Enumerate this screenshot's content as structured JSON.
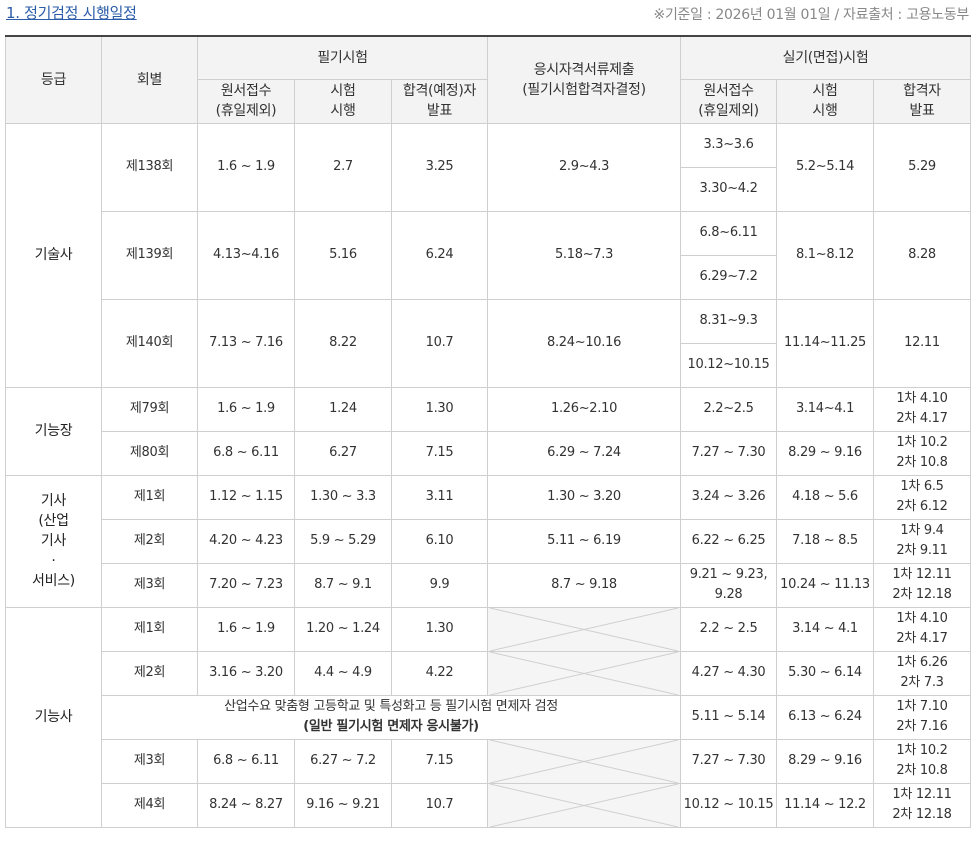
{
  "title": "1. 정기검정 시행일정",
  "note": "※기준일 : 2026년 01월 01일 / 자료출처 : 고용노동부",
  "headers": {
    "grade": "등급",
    "round": "회별",
    "written": "필기시험",
    "docs_line1": "응시자격서류제출",
    "docs_line2": "(필기시험합격자결정)",
    "practical": "실기(면접)시험",
    "apply_line1": "원서접수",
    "apply_line2": "(휴일제외)",
    "exam_line1": "시험",
    "exam_line2": "시행",
    "pass_exp_line1": "합격(예정)자",
    "pass_exp_line2": "발표",
    "p_apply_line1": "원서접수",
    "p_apply_line2": "(휴일제외)",
    "p_exam_line1": "시험",
    "p_exam_line2": "시행",
    "p_pass_line1": "합격자",
    "p_pass_line2": "발표"
  },
  "grades": {
    "gisulsa": "기술사",
    "gineungjang": "기능장",
    "gisa_line1": "기사",
    "gisa_line2": "(산업",
    "gisa_line3": "기사",
    "gisa_line4": "·",
    "gisa_line5": "서비스)",
    "gineungsa": "기능사"
  },
  "gisulsa": [
    {
      "round": "제138회",
      "w_apply": "1.6 ~ 1.9",
      "w_exam": "2.7",
      "w_pass": "3.25",
      "docs": "2.9~4.3",
      "p_apply_a": "3.3~3.6",
      "p_apply_b": "3.30~4.2",
      "p_exam": "5.2~5.14",
      "p_pass": "5.29"
    },
    {
      "round": "제139회",
      "w_apply": "4.13~4.16",
      "w_exam": "5.16",
      "w_pass": "6.24",
      "docs": "5.18~7.3",
      "p_apply_a": "6.8~6.11",
      "p_apply_b": "6.29~7.2",
      "p_exam": "8.1~8.12",
      "p_pass": "8.28"
    },
    {
      "round": "제140회",
      "w_apply": "7.13 ~ 7.16",
      "w_exam": "8.22",
      "w_pass": "10.7",
      "docs": "8.24~10.16",
      "p_apply_a": "8.31~9.3",
      "p_apply_b": "10.12~10.15",
      "p_exam": "11.14~11.25",
      "p_pass": "12.11"
    }
  ],
  "gineungjang": [
    {
      "round": "제79회",
      "w_apply": "1.6 ~ 1.9",
      "w_exam": "1.24",
      "w_pass": "1.30",
      "docs": "1.26~2.10",
      "p_apply": "2.2~2.5",
      "p_exam": "3.14~4.1",
      "p_pass_1": "1차 4.10",
      "p_pass_2": "2차 4.17"
    },
    {
      "round": "제80회",
      "w_apply": "6.8 ~ 6.11",
      "w_exam": "6.27",
      "w_pass": "7.15",
      "docs": "6.29 ~ 7.24",
      "p_apply": "7.27 ~ 7.30",
      "p_exam": "8.29 ~ 9.16",
      "p_pass_1": "1차 10.2",
      "p_pass_2": "2차 10.8"
    }
  ],
  "gisa": [
    {
      "round": "제1회",
      "w_apply": "1.12 ~ 1.15",
      "w_exam": "1.30 ~ 3.3",
      "w_pass": "3.11",
      "docs": "1.30 ~ 3.20",
      "p_apply_1": "3.24 ~ 3.26",
      "p_apply_2": "",
      "p_exam": "4.18 ~ 5.6",
      "p_pass_1": "1차 6.5",
      "p_pass_2": "2차 6.12"
    },
    {
      "round": "제2회",
      "w_apply": "4.20 ~ 4.23",
      "w_exam": "5.9 ~ 5.29",
      "w_pass": "6.10",
      "docs": "5.11 ~ 6.19",
      "p_apply_1": "6.22 ~ 6.25",
      "p_apply_2": "",
      "p_exam": "7.18 ~ 8.5",
      "p_pass_1": "1차 9.4",
      "p_pass_2": "2차 9.11"
    },
    {
      "round": "제3회",
      "w_apply": "7.20 ~ 7.23",
      "w_exam": "8.7 ~ 9.1",
      "w_pass": "9.9",
      "docs": "8.7 ~ 9.18",
      "p_apply_1": "9.21 ~ 9.23,",
      "p_apply_2": "9.28",
      "p_exam": "10.24 ~ 11.13",
      "p_pass_1": "1차 12.11",
      "p_pass_2": "2차 12.18"
    }
  ],
  "gineungsa": [
    {
      "round": "제1회",
      "w_apply": "1.6 ~ 1.9",
      "w_exam": "1.20 ~ 1.24",
      "w_pass": "1.30",
      "p_apply": "2.2 ~ 2.5",
      "p_exam": "3.14 ~ 4.1",
      "p_pass_1": "1차 4.10",
      "p_pass_2": "2차 4.17"
    },
    {
      "round": "제2회",
      "w_apply": "3.16 ~ 3.20",
      "w_exam": "4.4 ~ 4.9",
      "w_pass": "4.22",
      "p_apply": "4.27 ~ 4.30",
      "p_exam": "5.30 ~ 6.14",
      "p_pass_1": "1차 6.26",
      "p_pass_2": "2차 7.3"
    }
  ],
  "special": {
    "line1": "산업수요 맞춤형 고등학교 및 특성화고 등 필기시험 면제자 검정",
    "line2": "(일반 필기시험 면제자 응시불가)",
    "p_apply": "5.11 ~ 5.14",
    "p_exam": "6.13 ~ 6.24",
    "p_pass_1": "1차 7.10",
    "p_pass_2": "2차 7.16"
  },
  "gineungsa_late": [
    {
      "round": "제3회",
      "w_apply": "6.8 ~ 6.11",
      "w_exam": "6.27 ~ 7.2",
      "w_pass": "7.15",
      "p_apply": "7.27 ~ 7.30",
      "p_exam": "8.29 ~ 9.16",
      "p_pass_1": "1차 10.2",
      "p_pass_2": "2차 10.8"
    },
    {
      "round": "제4회",
      "w_apply": "8.24 ~ 8.27",
      "w_exam": "9.16 ~ 9.21",
      "w_pass": "10.7",
      "p_apply": "10.12 ~ 10.15",
      "p_exam": "11.14 ~ 12.2",
      "p_pass_1": "1차 12.11",
      "p_pass_2": "2차 12.18"
    }
  ]
}
